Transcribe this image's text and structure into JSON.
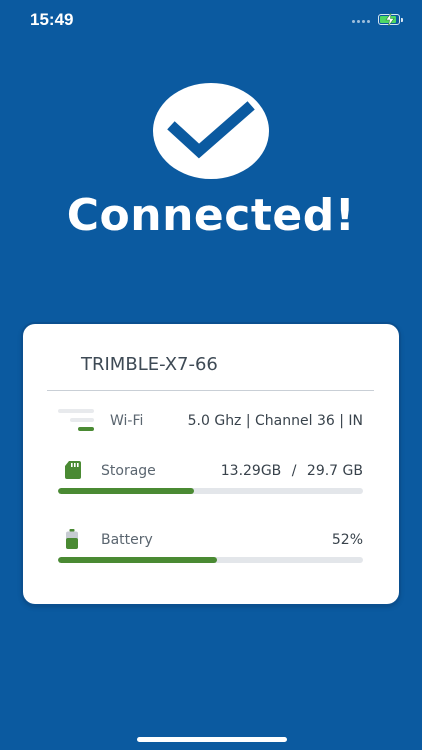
{
  "status_bar": {
    "time": "15:49",
    "battery_charging": true
  },
  "headline": "Connected!",
  "device": {
    "name": "TRIMBLE-X7-66"
  },
  "rows": {
    "wifi": {
      "icon": "wifi-signal-icon",
      "label": "Wi-Fi",
      "value": "5.0 Ghz | Channel 36 | IN"
    },
    "storage": {
      "icon": "sd-card-icon",
      "label": "Storage",
      "used": "13.29GB",
      "separator": "/",
      "total": "29.7 GB",
      "fraction": 0.447
    },
    "battery": {
      "icon": "battery-icon",
      "label": "Battery",
      "value": "52%",
      "fraction": 0.52
    }
  },
  "colors": {
    "background": "#0b5aa0",
    "accent_green": "#4a8a33",
    "check_blue": "#0b5aa0"
  }
}
